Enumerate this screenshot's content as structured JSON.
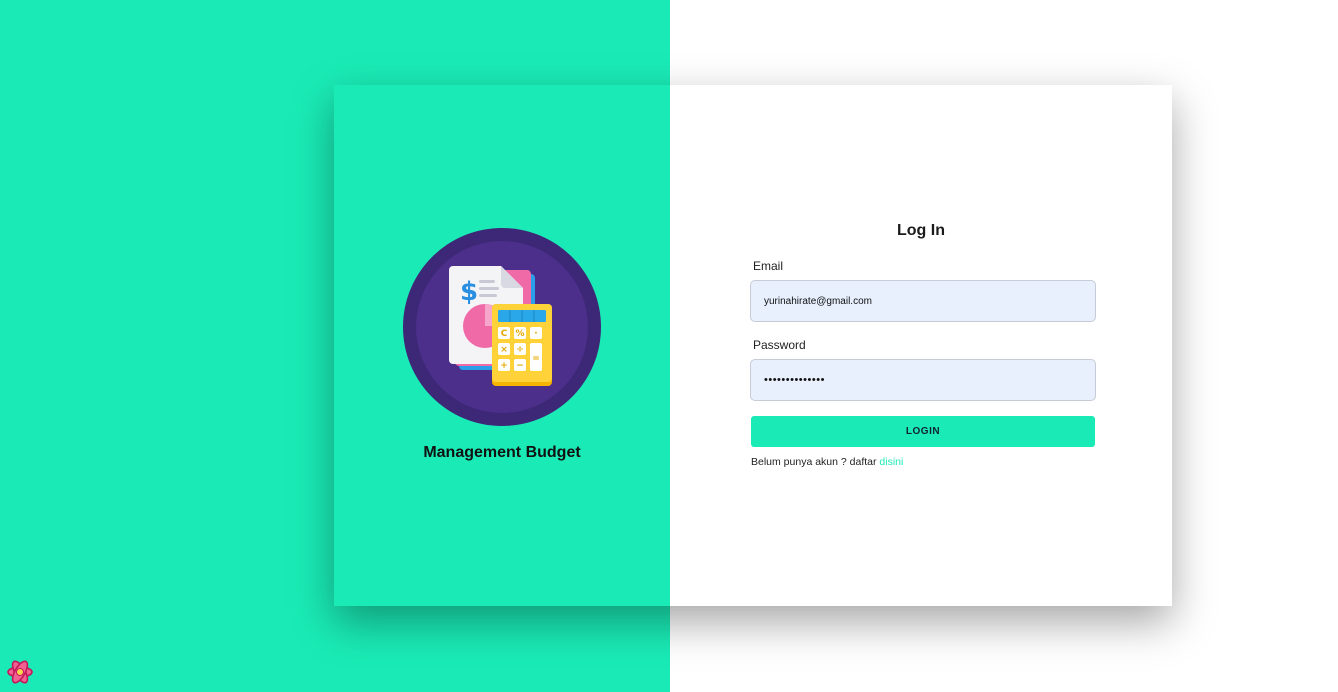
{
  "brand": {
    "title": "Management Budget"
  },
  "login": {
    "title": "Log In",
    "email_label": "Email",
    "email_value": "yurinahirate@gmail.com",
    "password_label": "Password",
    "password_value": "••••••••••••••",
    "button_label": "LOGIN",
    "signup_text": "Belum punya akun ? daftar",
    "signup_link": "disini"
  },
  "colors": {
    "accent": "#1aebb6",
    "logo_circle": "#3f2a7a",
    "input_bg": "#e8f0fe"
  },
  "icons": {
    "logo": "budget-calculator-icon",
    "corner": "react-icon"
  }
}
